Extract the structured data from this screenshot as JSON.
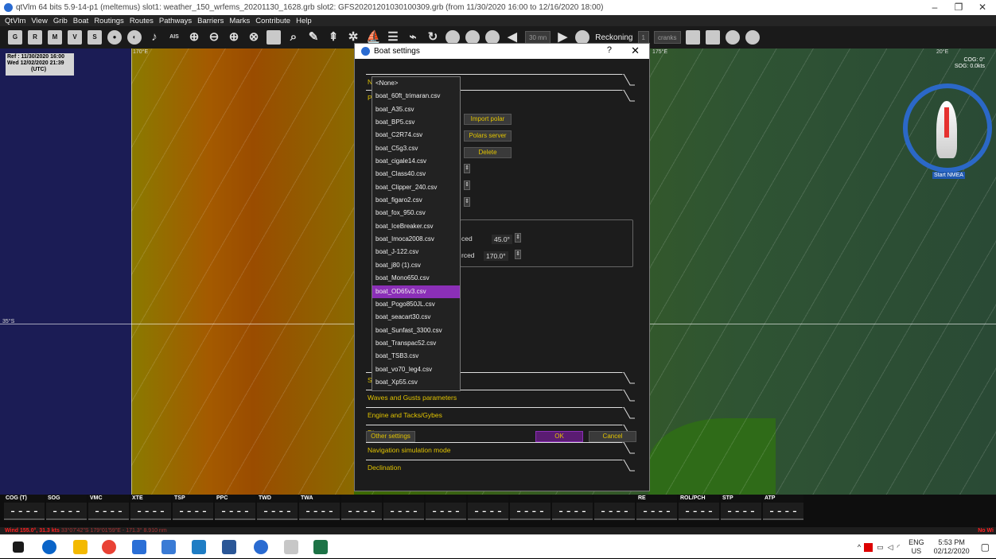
{
  "window": {
    "title": "qtVlm 64 bits 5.9-14-p1 (meltemus) slot1: weather_150_wrfems_20201130_1628.grb slot2: GFS20201201030100309.grb (from 11/30/2020 16:00 to 12/16/2020 18:00)",
    "minimize": "–",
    "maximize": "❐",
    "close": "✕"
  },
  "menu": [
    "QtVlm",
    "View",
    "Grib",
    "Boat",
    "Routings",
    "Routes",
    "Pathways",
    "Barriers",
    "Marks",
    "Contribute",
    "Help"
  ],
  "toolbar": {
    "buttons_left": [
      "G",
      "R",
      "M",
      "V",
      "S",
      "●",
      "◐",
      "♪",
      "AIS"
    ],
    "zoom_select": "30 mn",
    "reckoning": "Reckoning",
    "count": "1",
    "mode_select": "cranks"
  },
  "map": {
    "ref_line1": "Ref : 11/30/2020 16:00",
    "ref_line2": "Wed 12/02/2020 21:39",
    "ref_line3": "(UTC)",
    "lon_left": "170°E",
    "lon_mid": "175°E",
    "lon_right": "20°E",
    "lat_label": "35°S",
    "cog": "COG: 0°",
    "sog": "SOG: 0.0kts",
    "start_nmea": "Start NMEA"
  },
  "dialog": {
    "title": "Boat settings",
    "help": "?",
    "close": "✕",
    "sections_top": [
      "N",
      "P"
    ],
    "import_polar": "Import polar",
    "polars_server": "Polars server",
    "delete": "Delete",
    "angle1_label": "ced",
    "angle1_value": "45.0°",
    "angle2_label": "rced",
    "angle2_value": "170.0°",
    "section_s": "S",
    "sections": [
      "Waves and Gusts parameters",
      "Engine and Tacks/Gybes",
      "Dimensions",
      "Navigation simulation mode",
      "Declination"
    ],
    "other_settings": "Other settings",
    "ok": "OK",
    "cancel": "Cancel",
    "polar_options": [
      "<None>",
      "boat_60ft_trimaran.csv",
      "boat_A35.csv",
      "boat_BP5.csv",
      "boat_C2R74.csv",
      "boat_C5g3.csv",
      "boat_cigale14.csv",
      "boat_Class40.csv",
      "boat_Clipper_240.csv",
      "boat_figaro2.csv",
      "boat_fox_950.csv",
      "boat_IceBreaker.csv",
      "boat_Imoca2008.csv",
      "boat_J-122.csv",
      "boat_j80 (1).csv",
      "boat_Mono650.csv",
      "boat_OD65v3.csv",
      "boat_Pogo850JL.csv",
      "boat_seacart30.csv",
      "boat_Sunfast_3300.csv",
      "boat_Transpac52.csv",
      "boat_TSB3.csv",
      "boat_vo70_leg4.csv",
      "boat_Xp55.csv"
    ],
    "selected_index": 16
  },
  "instruments": [
    "COG (T)",
    "SOG",
    "VMC",
    "XTE",
    "TSP",
    "PPC",
    "TWD",
    "TWA",
    "",
    "",
    "",
    "",
    "",
    "",
    "",
    "RE",
    "ROL/PCH",
    "STP",
    "ATP"
  ],
  "instrument_value": "----",
  "status": {
    "left": "Wind 155.0°, 31.3 kts",
    "left_coords": "33°07'42\"S 179°01'59\"E - 171.3° 8.910 nm",
    "right": "No Wi"
  },
  "taskbar": {
    "lang1": "ENG",
    "lang2": "US",
    "time": "5:53 PM",
    "date": "02/12/2020"
  },
  "colors": {
    "accent_yellow": "#e2c400",
    "selection_purple": "#8b2fb7",
    "status_red": "#ff2020"
  }
}
